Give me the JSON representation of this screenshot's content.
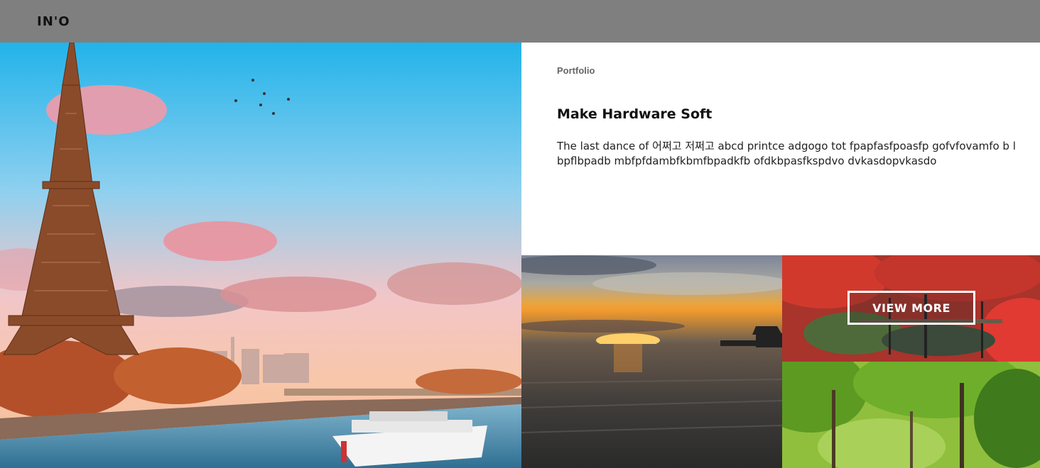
{
  "header": {
    "logo": "IN'O",
    "background": "#7f7f7f"
  },
  "portfolio": {
    "label": "Portfolio",
    "title": "Make Hardware Soft",
    "description": "The last dance of 어쩌고 저쩌고 abcd printce adgogo tot fpapfasfpoasfp gofvfovamfo b lbpflbpadb mbfpfdambfkbmfbpadkfb ofdkbpasfkspdvo dvkasdopvkasdo"
  },
  "gallery": {
    "hero": {
      "image": "eiffel-tower-seine-photo"
    },
    "tiles": [
      {
        "image": "ocean-sunset-photo"
      },
      {
        "image": "red-maple-garden-photo",
        "button_label": "VIEW MORE"
      },
      {
        "image": "green-forest-photo"
      }
    ]
  }
}
